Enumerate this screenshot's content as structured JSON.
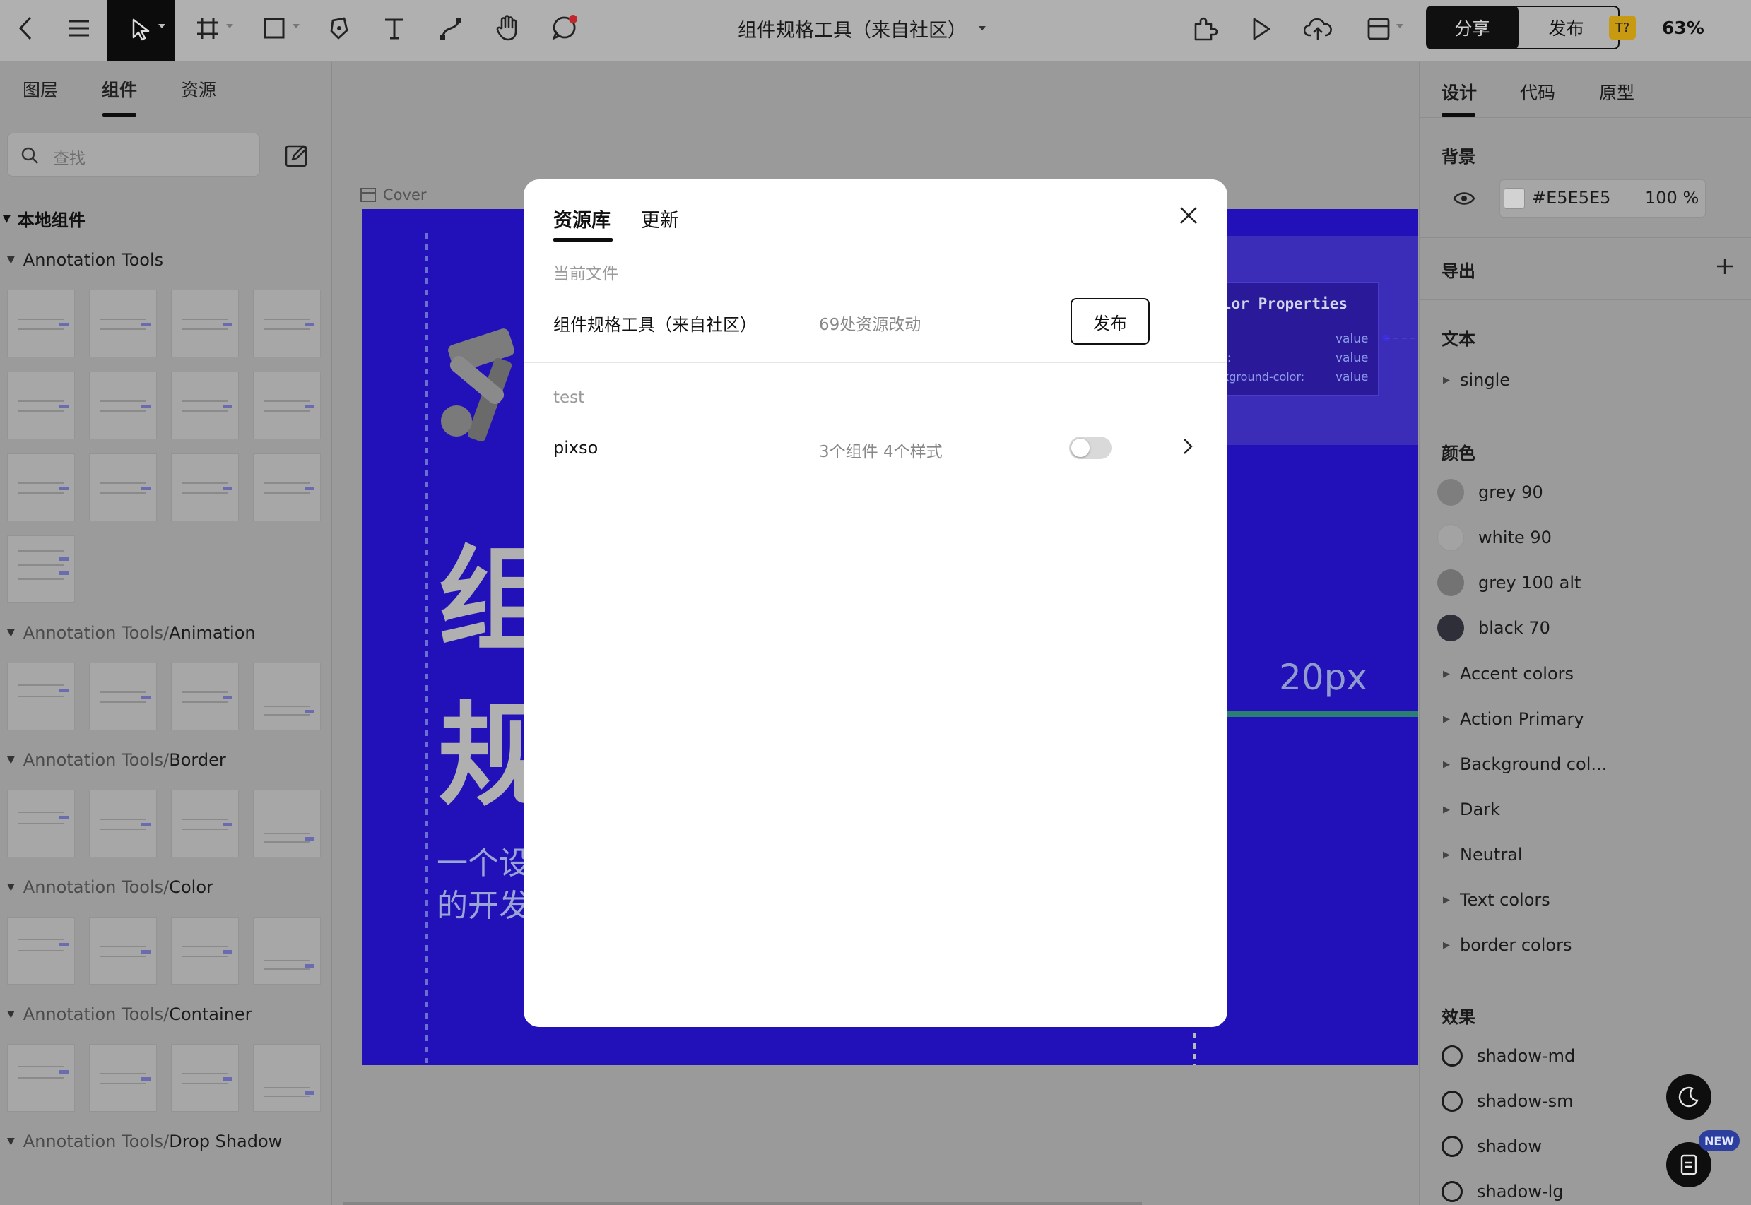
{
  "toolbar": {
    "doc_title": "组件规格工具（来自社区）",
    "share_label": "分享",
    "publish_label": "发布",
    "user_badge": "T?",
    "zoom": "63%"
  },
  "left_panel": {
    "tabs": [
      "图层",
      "组件",
      "资源"
    ],
    "active_tab": "组件",
    "search_placeholder": "查找",
    "local_components_title": "本地组件",
    "sections": [
      {
        "prefix": "",
        "name": "Annotation Tools"
      },
      {
        "prefix": "Annotation Tools/",
        "name": "Animation"
      },
      {
        "prefix": "Annotation Tools/",
        "name": "Border"
      },
      {
        "prefix": "Annotation Tools/",
        "name": "Color"
      },
      {
        "prefix": "Annotation Tools/",
        "name": "Container"
      },
      {
        "prefix": "Annotation Tools/",
        "name": "Drop Shadow"
      }
    ]
  },
  "canvas": {
    "frame_label": "Cover",
    "heading_chars": [
      "组",
      "规"
    ],
    "subtitle_lines": [
      "一个设",
      "的开发"
    ],
    "card_title": "lor Properties",
    "card_rows": [
      {
        "key": "",
        "value": "value"
      },
      {
        "key": "r:",
        "value": "value"
      },
      {
        "key": "kground-color:",
        "value": "value"
      }
    ],
    "spacing_label": "20px"
  },
  "right_panel": {
    "tabs": [
      "设计",
      "代码",
      "原型"
    ],
    "active_tab": "设计",
    "background_title": "背景",
    "background_hex_prefix": "#",
    "background_hex": "E5E5E5",
    "background_opacity": "100",
    "background_opacity_unit": "%",
    "export_title": "导出",
    "text_title": "文本",
    "text_styles": [
      "single"
    ],
    "color_title": "颜色",
    "colors": [
      {
        "name": "grey 90",
        "hex": "#7e7e7e"
      },
      {
        "name": "white 90",
        "hex": "#a3a3a3"
      },
      {
        "name": "grey 100 alt",
        "hex": "#737373"
      },
      {
        "name": "black 70",
        "hex": "#2f2f3a"
      }
    ],
    "color_groups": [
      "Accent colors",
      "Action Primary",
      "Background col...",
      "Dark",
      "Neutral",
      "Text colors",
      "border colors"
    ],
    "effects_title": "效果",
    "effects": [
      "shadow-md",
      "shadow-sm",
      "shadow",
      "shadow-lg"
    ],
    "new_badge": "NEW"
  },
  "modal": {
    "tabs": [
      "资源库",
      "更新"
    ],
    "active_tab": "资源库",
    "current_file_label": "当前文件",
    "current_file_name": "组件规格工具（来自社区）",
    "current_file_changes": "69处资源改动",
    "publish_label": "发布",
    "team_label": "test",
    "libraries": [
      {
        "name": "pixso",
        "summary": "3个组件 4个样式",
        "enabled": false
      }
    ]
  },
  "colors": {
    "frame_blue": "#2211b8",
    "accent_dark": "#0d0d0d",
    "badge_gold": "#c89a12"
  }
}
